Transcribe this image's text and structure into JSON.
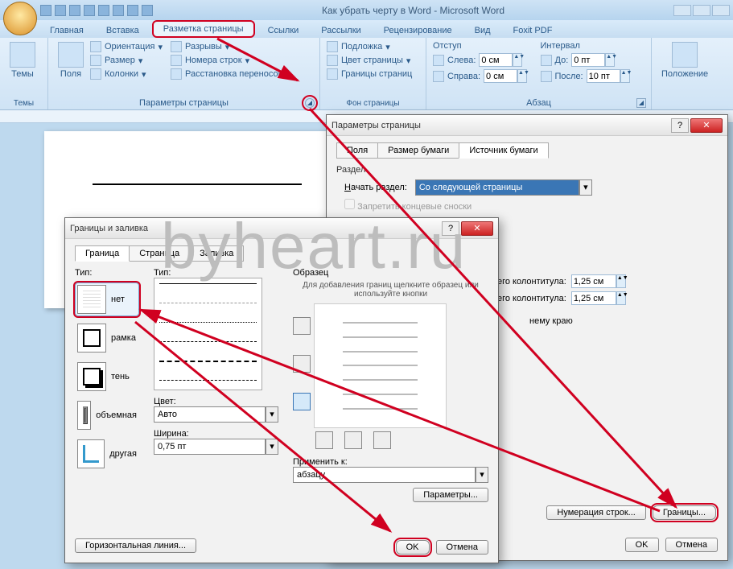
{
  "window": {
    "title": "Как убрать черту в Word - Microsoft Word"
  },
  "tabs": {
    "home": "Главная",
    "insert": "Вставка",
    "layout": "Разметка страницы",
    "references": "Ссылки",
    "mailings": "Рассылки",
    "review": "Рецензирование",
    "view": "Вид",
    "foxit": "Foxit PDF"
  },
  "ribbon": {
    "themes": {
      "btn": "Темы",
      "group": "Темы"
    },
    "page_setup": {
      "margins": "Поля",
      "orientation": "Ориентация",
      "size": "Размер",
      "columns": "Колонки",
      "breaks": "Разрывы",
      "line_numbers": "Номера строк",
      "hyphenation": "Расстановка переносов",
      "group": "Параметры страницы"
    },
    "page_bg": {
      "watermark": "Подложка",
      "color": "Цвет страницы",
      "borders": "Границы страниц",
      "group": "Фон страницы"
    },
    "paragraph": {
      "indent": "Отступ",
      "spacing": "Интервал",
      "left": "Слева:",
      "right": "Справа:",
      "before": "До:",
      "after": "После:",
      "left_val": "0 см",
      "right_val": "0 см",
      "before_val": "0 пт",
      "after_val": "10 пт",
      "group": "Абзац"
    },
    "arrange": {
      "position": "Положение"
    }
  },
  "dlg_pagesetup": {
    "title": "Параметры страницы",
    "tabs": {
      "fields": "Поля",
      "paper": "Размер бумаги",
      "source": "Источник бумаги"
    },
    "section": "Раздел",
    "start_section": "Начать раздел:",
    "start_section_val": "Со следующей страницы",
    "suppress_endnotes": "Запретить концевые сноски",
    "header_dist": "его колонтитула:",
    "footer_dist": "его колонтитула:",
    "header_val": "1,25 см",
    "footer_val": "1,25 см",
    "align": "нему краю",
    "line_numbers_btn": "Нумерация строк...",
    "borders_btn": "Границы...",
    "ok": "OK",
    "cancel": "Отмена"
  },
  "dlg_borders": {
    "title": "Границы и заливка",
    "tabs": {
      "border": "Граница",
      "page": "Страница",
      "shading": "Заливка"
    },
    "type_label": "Тип:",
    "types": {
      "none": "нет",
      "box": "рамка",
      "shadow": "тень",
      "threeD": "объемная",
      "custom": "другая"
    },
    "style_label": "Тип:",
    "color_label": "Цвет:",
    "color_val": "Авто",
    "width_label": "Ширина:",
    "width_val": "0,75 пт",
    "preview_label": "Образец",
    "preview_hint": "Для добавления границ щелкните образец или используйте кнопки",
    "apply_label": "Применить к:",
    "apply_val": "абзацу",
    "options_btn": "Параметры...",
    "hline_btn": "Горизонтальная линия...",
    "ok": "OK",
    "cancel": "Отмена"
  },
  "watermark": "byheart.ru"
}
